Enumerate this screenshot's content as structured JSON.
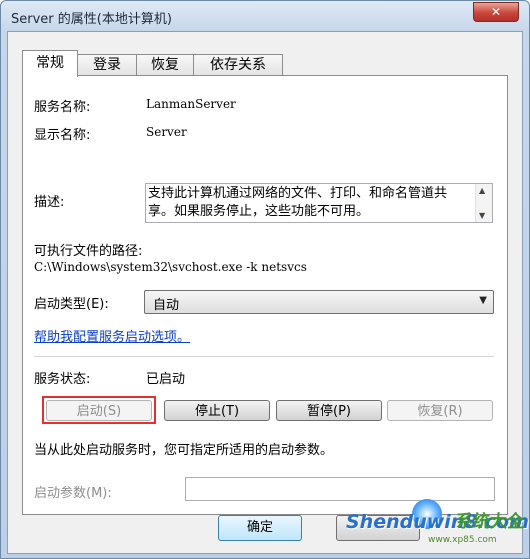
{
  "window": {
    "title": "Server 的属性(本地计算机)",
    "close_glyph": "✕"
  },
  "tabs": [
    {
      "label": "常规",
      "active": true
    },
    {
      "label": "登录",
      "active": false
    },
    {
      "label": "恢复",
      "active": false
    },
    {
      "label": "依存关系",
      "active": false
    }
  ],
  "general": {
    "service_name_label": "服务名称:",
    "service_name_value": "LanmanServer",
    "display_name_label": "显示名称:",
    "display_name_value": "Server",
    "description_label": "描述:",
    "description_value": "支持此计算机通过网络的文件、打印、和命名管道共享。如果服务停止，这些功能不可用。",
    "path_label": "可执行文件的路径:",
    "path_value": "C:\\Windows\\system32\\svchost.exe -k netsvcs",
    "startup_type_label": "启动类型(E):",
    "startup_type_value": "自动",
    "help_link": "帮助我配置服务启动选项。",
    "status_label": "服务状态:",
    "status_value": "已启动",
    "start_button": "启动(S)",
    "stop_button": "停止(T)",
    "pause_button": "暂停(P)",
    "resume_button": "恢复(R)",
    "hint": "当从此处启动服务时，您可指定所适用的启动参数。",
    "params_label": "启动参数(M):",
    "params_value": ""
  },
  "footer": {
    "ok_button": "确定"
  },
  "watermark": {
    "text": "Shenduwin8.com",
    "cn": "系统大全",
    "sub": "www.xp85.com"
  },
  "colors": {
    "highlight": "#e53030",
    "link": "#0a3ec7"
  }
}
